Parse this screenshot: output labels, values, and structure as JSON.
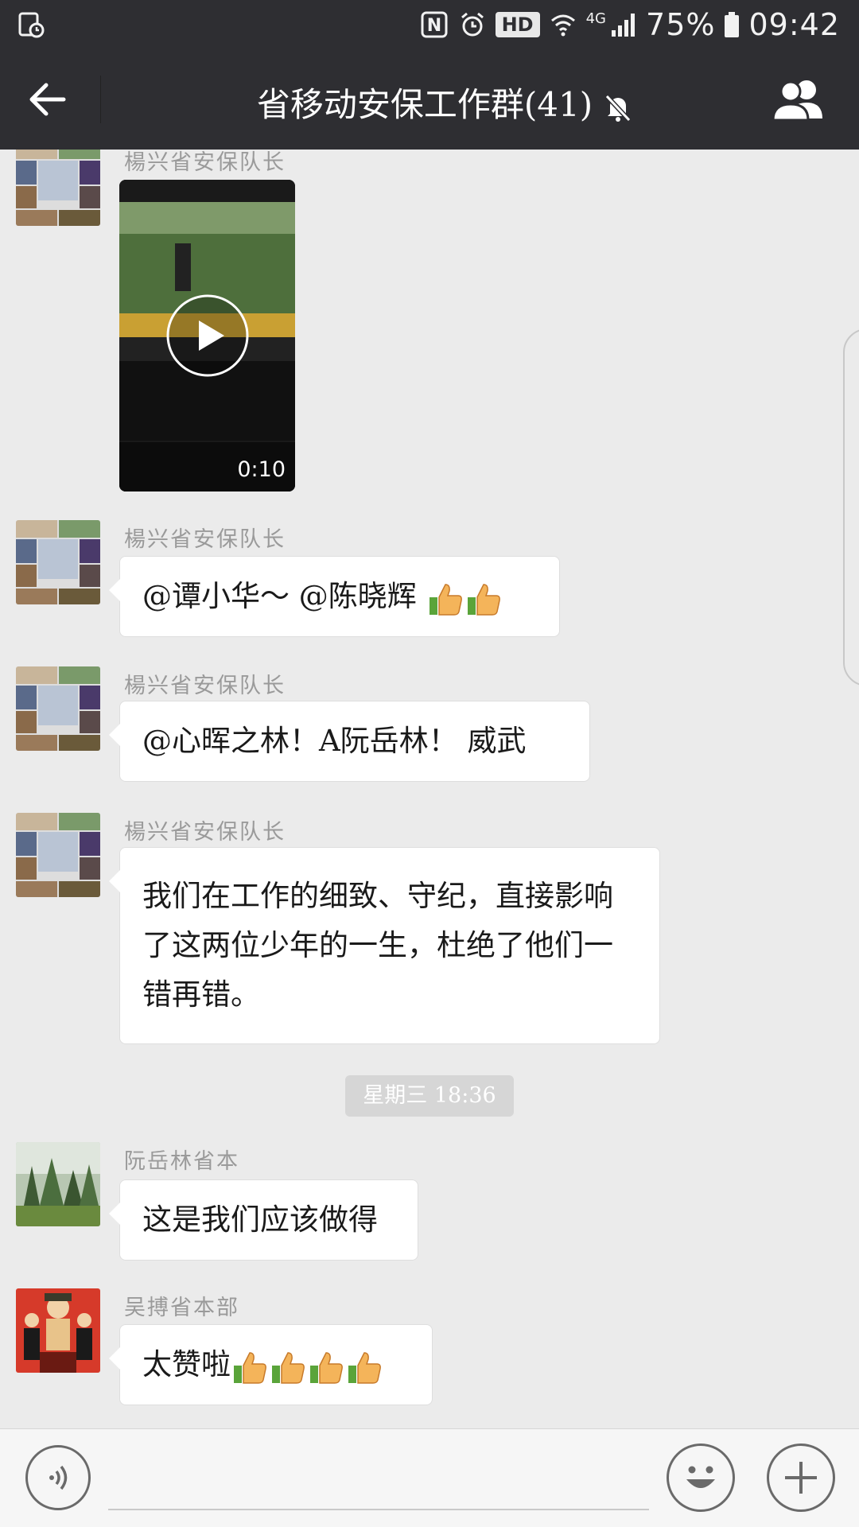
{
  "status_bar": {
    "network_type": "4G",
    "hd_label": "HD",
    "battery_percent": "75%",
    "time": "09:42"
  },
  "header": {
    "title": "省移动安保工作群(41)"
  },
  "messages": [
    {
      "sender": "楊兴省安保队长",
      "type": "video",
      "duration": "0:10"
    },
    {
      "sender": "楊兴省安保队长",
      "type": "text",
      "text": "@谭小华～ @陈晓辉 ",
      "emoji": "thumbs-up x2"
    },
    {
      "sender": "楊兴省安保队长",
      "type": "text",
      "text": "@心晖之林！A阮岳林！ 威武"
    },
    {
      "sender": "楊兴省安保队长",
      "type": "text",
      "lines": [
        "我们在工作的细致、守纪，直接影响",
        "了这两位少年的一生，杜绝了他们一",
        "错再错。"
      ]
    },
    {
      "type": "timestamp",
      "text": "星期三 18:36"
    },
    {
      "sender": "阮岳林省本",
      "type": "text",
      "text": "这是我们应该做得"
    },
    {
      "sender": "吴搏省本部",
      "type": "text",
      "text": "太赞啦",
      "emoji": "thumbs-up x4"
    }
  ],
  "colors": {
    "header_bg": "#2e2e32",
    "chat_bg": "#ebebeb",
    "bubble_bg": "#ffffff"
  }
}
